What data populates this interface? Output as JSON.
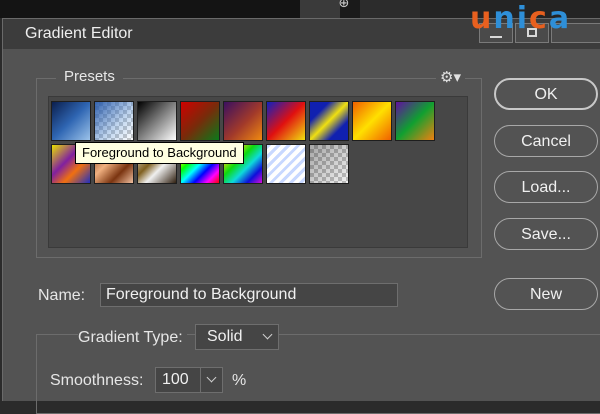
{
  "dialog": {
    "title": "Gradient Editor"
  },
  "brand": {
    "logo_text": "unica",
    "colors": {
      "orange": "#e8601f",
      "blue": "#2e8fd8"
    }
  },
  "presets": {
    "label": "Presets",
    "settings_icon": "gear-icon",
    "tooltip": "Foreground to Background",
    "swatches": [
      {
        "name": "foreground-to-background",
        "style": "linear-gradient(135deg,#0b1f4d,#2f66b3 50%,#9cc3ea)"
      },
      {
        "name": "foreground-to-transparent",
        "style": "checker-blue"
      },
      {
        "name": "black-white",
        "style": "linear-gradient(135deg,#000,#fff)"
      },
      {
        "name": "red-green",
        "style": "linear-gradient(135deg,#d00000,#7a2a0a 50%,#0a7a1a)"
      },
      {
        "name": "violet-orange",
        "style": "linear-gradient(135deg,#3a1060,#a23a2a 55%,#f08a10)"
      },
      {
        "name": "blue-red-yellow",
        "style": "linear-gradient(135deg,#1020c0,#e01010 50%,#f0e010)"
      },
      {
        "name": "blue-yellow-blue",
        "style": "linear-gradient(135deg,#1020b0 25%,#f0e010 50%,#1020b0 75%)"
      },
      {
        "name": "orange-yellow-orange",
        "style": "linear-gradient(135deg,#f06000,#ffe000 50%,#f06000)"
      },
      {
        "name": "violet-green-orange",
        "style": "linear-gradient(135deg,#6010a0,#10a030 50%,#f08010)"
      },
      {
        "name": "yellow-violet-orange-blue",
        "style": "linear-gradient(135deg,#e8e000,#8020a0 40%,#f07010 65%,#2030c0)"
      },
      {
        "name": "copper",
        "style": "linear-gradient(135deg,#7a3410,#f0b080 40%,#7a3410 70%,#f0c0a0)"
      },
      {
        "name": "chrome",
        "style": "linear-gradient(135deg,#f0f0f0,#806020 40%,#f0f0f0 60%,#302010)"
      },
      {
        "name": "spectrum",
        "style": "linear-gradient(135deg,#ff0000,#ffff00,#00ff00,#00ffff,#0000ff,#ff00ff,#ff0000)"
      },
      {
        "name": "transparent-rainbow",
        "style": "linear-gradient(135deg,rgba(255,0,0,.8),rgba(255,255,0,.8),rgba(0,255,0,.8),rgba(0,255,255,.8),rgba(0,0,255,.8),rgba(255,0,255,.8))"
      },
      {
        "name": "transparent-stripes",
        "style": "repeating-linear-gradient(135deg,#c8d8ff 0,#c8d8ff 3px,#ffffff 3px,#ffffff 7px)"
      },
      {
        "name": "neutral-density",
        "style": "checker-dark"
      }
    ]
  },
  "buttons": {
    "ok": "OK",
    "cancel": "Cancel",
    "load": "Load...",
    "save": "Save...",
    "new": "New"
  },
  "name_row": {
    "label": "Name:",
    "value": "Foreground to Background"
  },
  "gradient": {
    "type_label": "Gradient Type:",
    "type_value": "Solid",
    "smoothness_label": "Smoothness:",
    "smoothness_value": "100",
    "smoothness_unit": "%"
  },
  "icons": {
    "window_min": "minimize-icon",
    "window_max": "maximize-icon",
    "background_icon": "ps-icon"
  }
}
